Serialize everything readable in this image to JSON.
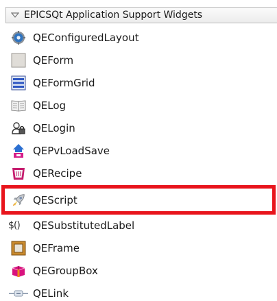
{
  "category": {
    "title": "EPICSQt Application Support Widgets",
    "expanded": true
  },
  "widgets": [
    {
      "label": "QEConfiguredLayout",
      "icon": "configured-layout-icon"
    },
    {
      "label": "QEForm",
      "icon": "form-icon"
    },
    {
      "label": "QEFormGrid",
      "icon": "form-grid-icon"
    },
    {
      "label": "QELog",
      "icon": "log-book-icon"
    },
    {
      "label": "QELogin",
      "icon": "login-lock-icon"
    },
    {
      "label": "QEPvLoadSave",
      "icon": "pv-load-save-icon"
    },
    {
      "label": "QERecipe",
      "icon": "recipe-icon"
    },
    {
      "label": "QEScript",
      "icon": "rocket-script-icon"
    },
    {
      "label": "QESubstitutedLabel",
      "icon": "substituted-label-icon",
      "icon_text": "$()"
    },
    {
      "label": "QEFrame",
      "icon": "frame-icon"
    },
    {
      "label": "QEGroupBox",
      "icon": "group-box-icon"
    },
    {
      "label": "QELink",
      "icon": "link-icon"
    }
  ],
  "highlighted_item": "QEScript",
  "colors": {
    "highlight_border": "#e8141c",
    "text": "#1a1a1a"
  }
}
